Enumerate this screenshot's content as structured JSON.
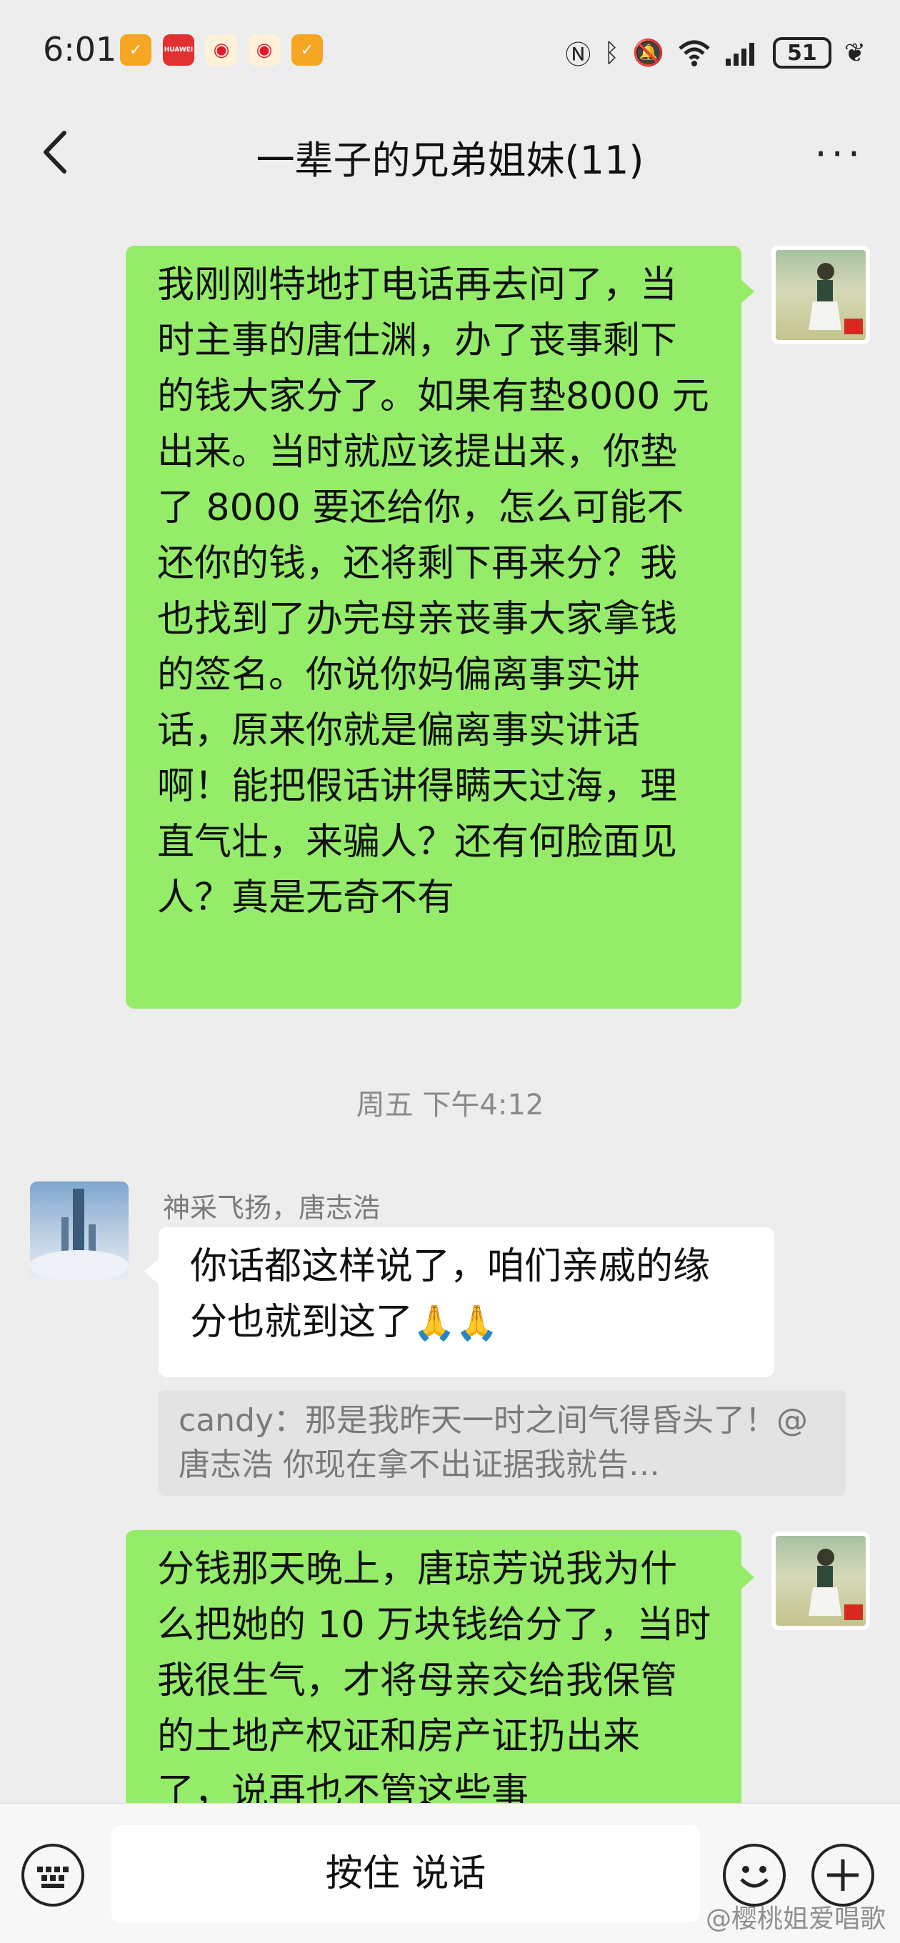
{
  "status_bar": {
    "time": "6:01",
    "app_icons": [
      "notification-app-icon",
      "huawei-icon",
      "weibo-icon",
      "weibo-icon",
      "notification-app-icon"
    ],
    "battery": "51",
    "huawei_label": "HUAWEI"
  },
  "header": {
    "title": "一辈子的兄弟姐妹(11)",
    "more": "···"
  },
  "messages": {
    "msg1": {
      "text": "我刚刚特地打电话再去问了，当时主事的唐仕渊，办了丧事剩下的钱大家分了。如果有垫8000 元出来。当时就应该提出来，你垫了 8000 要还给你，怎么可能不还你的钱，还将剩下再来分？我也找到了办完母亲丧事大家拿钱的签名。你说你妈偏离事实讲话，原来你就是偏离事实讲话啊！能把假话讲得瞒天过海，理直气壮，来骗人？还有何脸面见人？真是无奇不有"
    },
    "timestamp": "周五 下午4:12",
    "msg2": {
      "sender": "神采飞扬，唐志浩",
      "text": "你话都这样说了，咱们亲戚的缘分也就到这了",
      "emoji": "🙏🙏",
      "quote": "candy：那是我昨天一时之间气得昏头了！@唐志浩 你现在拿不出证据我就告…"
    },
    "msg3": {
      "text": "分钱那天晚上，唐琼芳说我为什么把她的 10 万块钱给分了，当时我很生气，才将母亲交给我保管的土地产权证和房产证扔出来了，说再也不管这些事"
    }
  },
  "input_bar": {
    "hold_to_talk": "按住 说话"
  },
  "watermark": "@樱桃姐爱唱歌"
}
